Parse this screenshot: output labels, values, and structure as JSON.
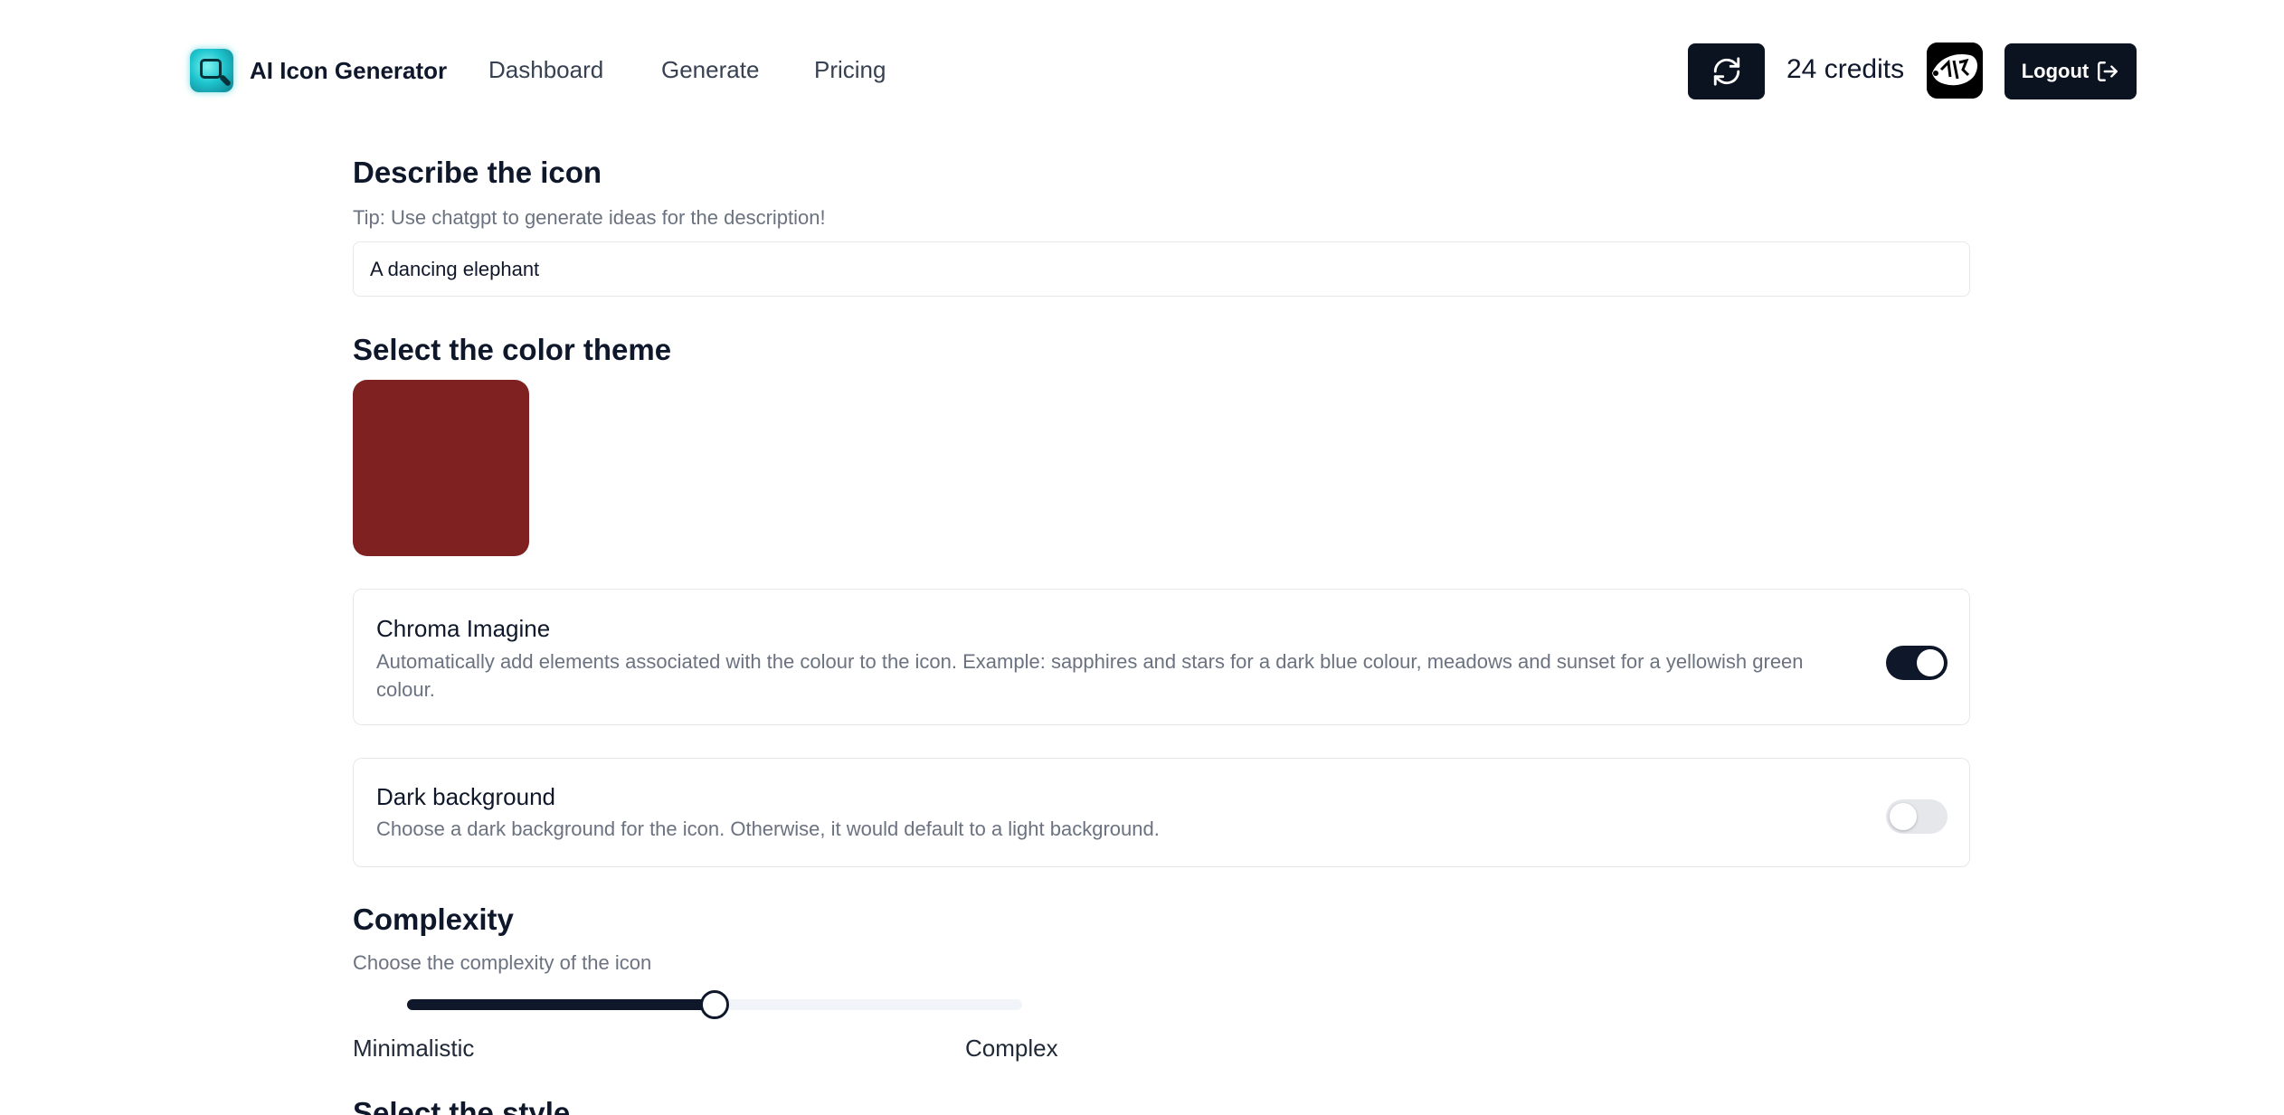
{
  "header": {
    "brand_name": "AI Icon Generator",
    "nav": [
      {
        "label": "Dashboard"
      },
      {
        "label": "Generate"
      },
      {
        "label": "Pricing"
      }
    ],
    "credits": "24 credits",
    "logout_label": "Logout"
  },
  "describe": {
    "title": "Describe the icon",
    "tip": "Tip: Use chatgpt to generate ideas for the description!",
    "value": "A dancing elephant"
  },
  "color_theme": {
    "title": "Select the color theme",
    "selected_color": "#7f2121"
  },
  "chroma": {
    "title": "Chroma Imagine",
    "description": "Automatically add elements associated with the colour to the icon. Example: sapphires and stars for a dark blue colour, meadows and sunset for a yellowish green colour.",
    "enabled": true
  },
  "dark_background": {
    "title": "Dark background",
    "description": "Choose a dark background for the icon. Otherwise, it would default to a light background.",
    "enabled": false
  },
  "complexity": {
    "title": "Complexity",
    "subtitle": "Choose the complexity of the icon",
    "value_fraction": 0.5,
    "min_label": "Minimalistic",
    "max_label": "Complex"
  },
  "style": {
    "title": "Select the style"
  },
  "colors": {
    "primary": "#0f172a",
    "muted_text": "#6b7280",
    "border": "#e5e7eb"
  }
}
